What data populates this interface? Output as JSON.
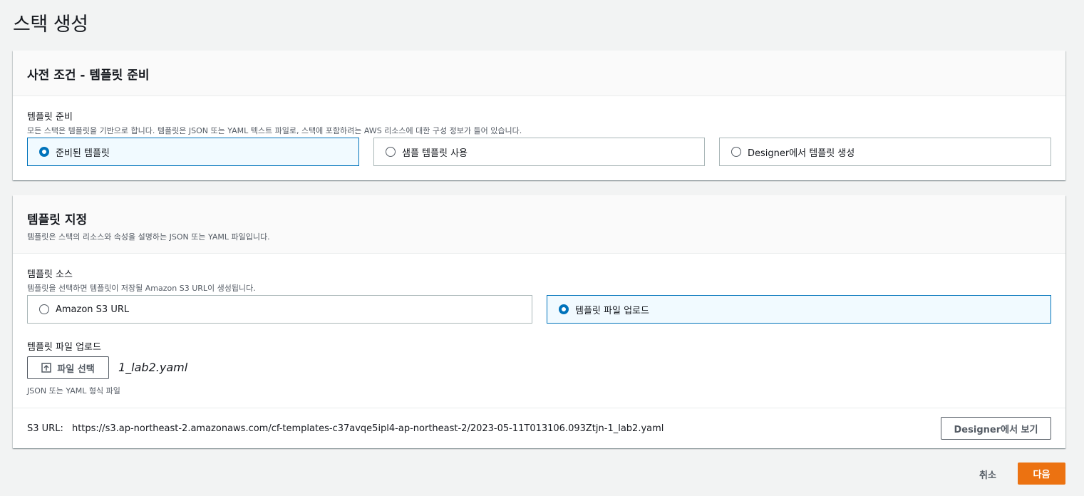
{
  "page": {
    "title": "스택 생성"
  },
  "prerequisite": {
    "title": "사전 조건 - 템플릿 준비",
    "field_label": "템플릿 준비",
    "field_desc": "모든 스택은 템플릿을 기반으로 합니다. 템플릿은 JSON 또는 YAML 텍스트 파일로, 스택에 포함하려는 AWS 리소스에 대한 구성 정보가 들어 있습니다.",
    "options": [
      {
        "label": "준비된 템플릿",
        "selected": true
      },
      {
        "label": "샘플 템플릿 사용",
        "selected": false
      },
      {
        "label": "Designer에서 템플릿 생성",
        "selected": false
      }
    ]
  },
  "specify": {
    "title": "템플릿 지정",
    "desc": "템플릿은 스택의 리소스와 속성을 설명하는 JSON 또는 YAML 파일입니다.",
    "source_label": "템플릿 소스",
    "source_desc": "템플릿을 선택하면 템플릿이 저장될 Amazon S3 URL이 생성됩니다.",
    "source_options": [
      {
        "label": "Amazon S3 URL",
        "selected": false
      },
      {
        "label": "템플릿 파일 업로드",
        "selected": true
      }
    ],
    "upload_label": "템플릿 파일 업로드",
    "choose_file_label": "파일 선택",
    "file_name": "1_lab2.yaml",
    "file_hint": "JSON 또는 YAML 형식 파일",
    "s3_url_label": "S3 URL:",
    "s3_url": "https://s3.ap-northeast-2.amazonaws.com/cf-templates-c37avqe5ipl4-ap-northeast-2/2023-05-11T013106.093Ztjn-1_lab2.yaml",
    "view_designer_label": "Designer에서 보기"
  },
  "footer": {
    "cancel_label": "취소",
    "next_label": "다음"
  },
  "colors": {
    "accent": "#0073bb",
    "primary": "#ec7211",
    "selected_bg": "#f1faff"
  }
}
